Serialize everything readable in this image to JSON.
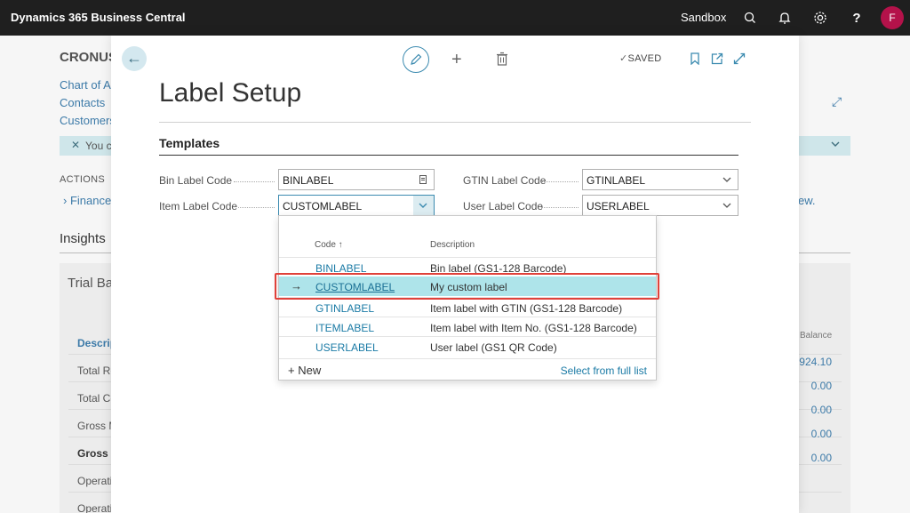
{
  "appbar": {
    "title": "Dynamics 365 Business Central",
    "environment": "Sandbox",
    "avatar_initial": "F"
  },
  "background": {
    "company": "CRONUS",
    "links": [
      "Chart of A",
      "Contacts",
      "Customers"
    ],
    "banner_text": "You c",
    "actions_label": "ACTIONS",
    "finance_link": "Finance",
    "view_link": "ew.",
    "insights_label": "Insights",
    "card_title": "Trial Ba",
    "col_desc": "Descrip",
    "col_balance": "Balance",
    "rows": [
      {
        "label": "Total Re",
        "value": "924.10",
        "bold": false
      },
      {
        "label": "Total Co",
        "value": "0.00",
        "bold": false
      },
      {
        "label": "Gross M",
        "value": "0.00",
        "bold": false
      },
      {
        "label": "Gross M",
        "value": "0.00",
        "bold": true
      },
      {
        "label": "Operati",
        "value": "0.00",
        "bold": false
      },
      {
        "label": "Operati",
        "value": "",
        "bold": false
      }
    ]
  },
  "toolbar": {
    "saved_label": "SAVED"
  },
  "page": {
    "title": "Label Setup",
    "section": "Templates"
  },
  "fields": {
    "bin_label_code": {
      "label": "Bin Label Code",
      "value": "BINLABEL"
    },
    "item_label_code": {
      "label": "Item Label Code",
      "value": "CUSTOMLABEL"
    },
    "gtin_label_code": {
      "label": "GTIN Label Code",
      "value": "GTINLABEL"
    },
    "user_label_code": {
      "label": "User Label Code",
      "value": "USERLABEL"
    }
  },
  "dropdown": {
    "col_code": "Code ↑",
    "col_description": "Description",
    "rows": [
      {
        "code": "BINLABEL",
        "description": "Bin label (GS1-128 Barcode)",
        "selected": false
      },
      {
        "code": "CUSTOMLABEL",
        "description": "My custom label",
        "selected": true
      },
      {
        "code": "GTINLABEL",
        "description": "Item label with GTIN (GS1-128 Barcode)",
        "selected": false
      },
      {
        "code": "ITEMLABEL",
        "description": "Item label with Item No. (GS1-128 Barcode)",
        "selected": false
      },
      {
        "code": "USERLABEL",
        "description": "User label (GS1 QR Code)",
        "selected": false
      }
    ],
    "new_label": "New",
    "new_glyph": "+",
    "full_list_label": "Select from full list",
    "selected_arrow": "→"
  },
  "colors": {
    "appbar_bg": "#1f1f1f",
    "avatar_bg": "#b4124a",
    "accent": "#1a7aa5",
    "selected_row": "#aee4ea",
    "highlight": "#e0413a"
  },
  "icons": [
    "search-icon",
    "bell-icon",
    "gear-icon",
    "help-icon",
    "back-arrow-icon",
    "edit-pencil-icon",
    "plus-icon",
    "trash-icon",
    "checkmark-icon",
    "bookmark-icon",
    "share-icon",
    "expand-icon",
    "lookup-icon",
    "chevron-down-icon"
  ]
}
